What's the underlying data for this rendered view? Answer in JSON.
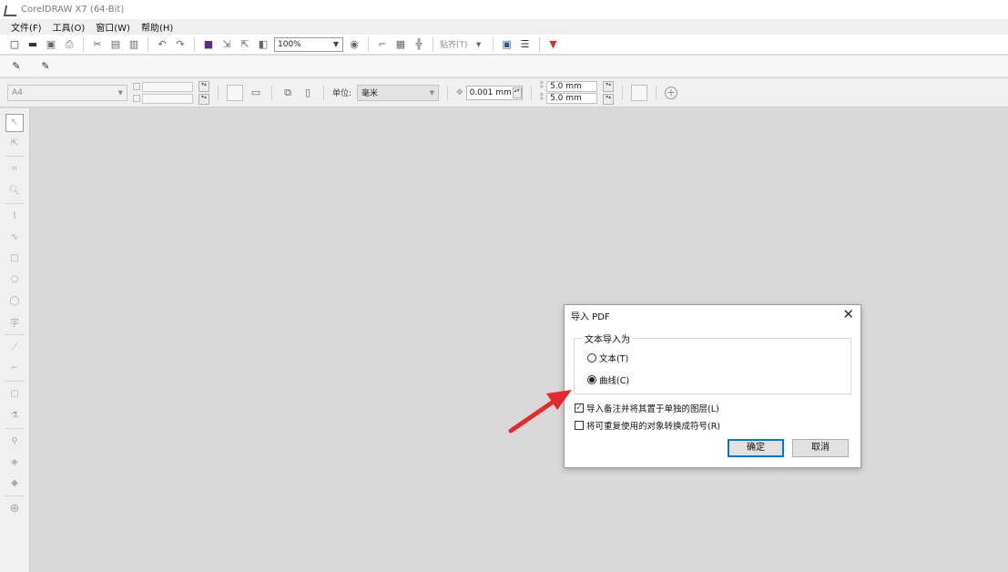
{
  "window": {
    "title": "CorelDRAW X7 (64-Bit)"
  },
  "menu": {
    "items": [
      "文件(F)",
      "工具(O)",
      "窗口(W)",
      "帮助(H)"
    ]
  },
  "toolbar": {
    "zoom": "100%",
    "snap_label": "贴齐(T)"
  },
  "property_bar": {
    "page_size": "A4",
    "units_label": "单位:",
    "units_value": "毫米",
    "nudge": "0.001 mm",
    "dup_x": "5.0 mm",
    "dup_y": "5.0 mm"
  },
  "dialog": {
    "title": "导入 PDF",
    "group_label": "文本导入为",
    "option_text": "文本(T)",
    "option_curves": "曲线(C)",
    "selected_option": "曲线(C)",
    "check_import_notes": "导入备注并将其置于单独的图层(L)",
    "check_import_notes_checked": true,
    "check_convert_symbols": "将可重复使用的对象转换成符号(R)",
    "check_convert_symbols_checked": false,
    "ok_label": "确定",
    "cancel_label": "取消",
    "close_glyph": "✕"
  },
  "annotation": {
    "arrow_color": "#e32b2b"
  },
  "icons": {
    "toolbar": [
      "new-doc-icon",
      "open-icon",
      "save-icon",
      "print-icon",
      "cut-icon",
      "copy-icon",
      "paste-icon",
      "undo-icon",
      "redo-icon",
      "import-icon",
      "export-icon",
      "publish-pdf-icon",
      "zoom-dropdown",
      "full-screen-icon",
      "rulers-icon",
      "guides-icon",
      "snap-icon",
      "welcome-icon",
      "options-icon",
      "app-launcher-icon"
    ],
    "toolbox": [
      "pick-tool-icon",
      "shape-tool-icon",
      "crop-tool-icon",
      "zoom-tool-icon",
      "freehand-tool-icon",
      "artistic-media-icon",
      "rectangle-tool-icon",
      "ellipse-tool-icon",
      "polygon-tool-icon",
      "text-tool-icon",
      "parallel-dimension-icon",
      "connector-tool-icon",
      "drop-shadow-icon",
      "transparency-icon",
      "color-eyedropper-icon",
      "interactive-fill-icon",
      "smart-fill-icon",
      "add-tool-icon"
    ]
  }
}
